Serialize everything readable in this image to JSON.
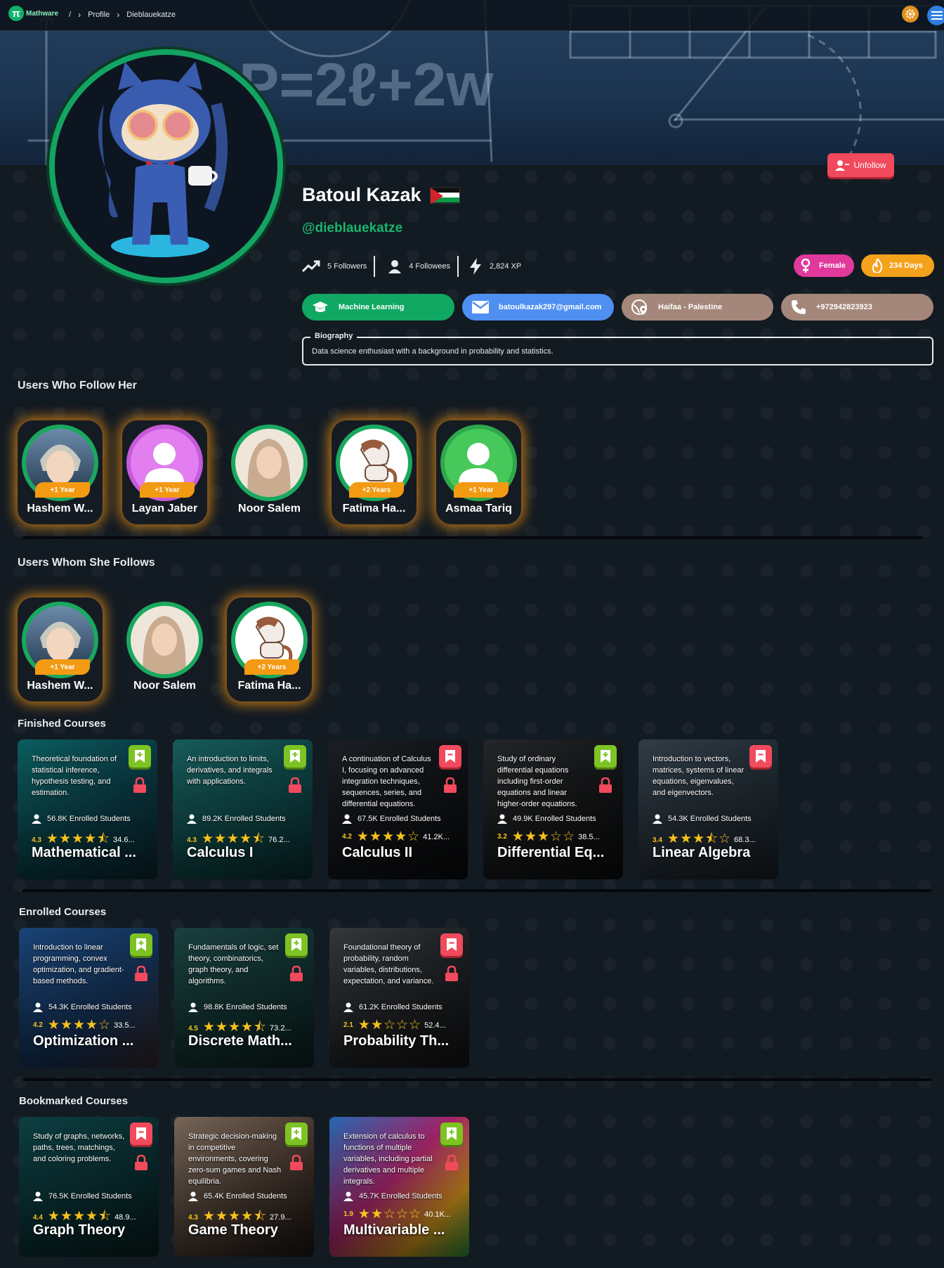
{
  "nav": {
    "logo_text": "Mathware",
    "crumbs": [
      "/",
      "Profile",
      "Dieblauekatze"
    ]
  },
  "profile": {
    "unfollow_label": "Unfollow",
    "name": "Batoul Kazak",
    "handle": "@dieblauekatze",
    "followers": "5 Followers",
    "followees": "4 Followees",
    "xp": "2,824 XP",
    "gender": "Female",
    "streak": "234 Days",
    "course_tag": "Machine Learning",
    "email": "batoulkazak297@gmail.com",
    "location": "Haifaa - Palestine",
    "phone": "+972942823923",
    "bio_label": "Biography",
    "bio": "Data science enthusiast with a background in probability and statistics."
  },
  "sections": {
    "followers_title": "Users Who Follow Her",
    "followees_title": "Users Whom She Follows",
    "finished_title": "Finished Courses",
    "enrolled_title": "Enrolled Courses",
    "bookmarked_title": "Bookmarked Courses"
  },
  "followers": [
    {
      "name": "Hashem W...",
      "badge": "+1 Year"
    },
    {
      "name": "Layan Jaber",
      "badge": "+1 Year"
    },
    {
      "name": "Noor Salem",
      "badge": ""
    },
    {
      "name": "Fatima Ha...",
      "badge": "+2 Years"
    },
    {
      "name": "Asmaa Tariq",
      "badge": "+1 Year"
    }
  ],
  "followees": [
    {
      "name": "Hashem W...",
      "badge": "+1 Year"
    },
    {
      "name": "Noor Salem",
      "badge": ""
    },
    {
      "name": "Fatima Ha...",
      "badge": "+2 Years"
    }
  ],
  "finished": [
    {
      "desc": "Theoretical foundation of statistical inference, hypothesis testing, and estimation.",
      "enrolled": "56.8K Enrolled Students",
      "rating": "4.3",
      "stars": "★★★★⯪",
      "reviews": "34.6...",
      "title": "Mathematical ..."
    },
    {
      "desc": "An introduction to limits, derivatives, and integrals with applications.",
      "enrolled": "89.2K Enrolled Students",
      "rating": "4.3",
      "stars": "★★★★⯪",
      "reviews": "76.2...",
      "title": "Calculus I"
    },
    {
      "desc": "A continuation of Calculus I, focusing on advanced integration techniques, sequences, series, and differential equations.",
      "enrolled": "67.5K Enrolled Students",
      "rating": "4.2",
      "stars": "★★★★☆",
      "reviews": "41.2K...",
      "title": "Calculus II"
    },
    {
      "desc": "Study of ordinary differential equations including first-order equations and linear higher-order equations.",
      "enrolled": "49.9K Enrolled Students",
      "rating": "3.2",
      "stars": "★★★☆☆",
      "reviews": "38.5...",
      "title": "Differential Eq..."
    },
    {
      "desc": "Introduction to vectors, matrices, systems of linear equations, eigenvalues, and eigenvectors.",
      "enrolled": "54.3K Enrolled Students",
      "rating": "3.4",
      "stars": "★★★⯪☆",
      "reviews": "68.3...",
      "title": "Linear Algebra"
    }
  ],
  "enrolled": [
    {
      "desc": "Introduction to linear programming, convex optimization, and gradient-based methods.",
      "enrolled": "54.3K Enrolled Students",
      "rating": "4.2",
      "stars": "★★★★☆",
      "reviews": "33.5...",
      "title": "Optimization ..."
    },
    {
      "desc": "Fundamentals of logic, set theory, combinatorics, graph theory, and algorithms.",
      "enrolled": "98.8K Enrolled Students",
      "rating": "4.5",
      "stars": "★★★★⯪",
      "reviews": "73.2...",
      "title": "Discrete Math..."
    },
    {
      "desc": "Foundational theory of probability, random variables, distributions, expectation, and variance.",
      "enrolled": "61.2K Enrolled Students",
      "rating": "2.1",
      "stars": "★★☆☆☆",
      "reviews": "52.4...",
      "title": "Probability Th..."
    }
  ],
  "bookmarked": [
    {
      "desc": "Study of graphs, networks, paths, trees, matchings, and coloring problems.",
      "enrolled": "76.5K Enrolled Students",
      "rating": "4.4",
      "stars": "★★★★⯪",
      "reviews": "48.9...",
      "title": "Graph Theory"
    },
    {
      "desc": "Strategic decision-making in competitive environments, covering zero-sum games and Nash equilibria.",
      "enrolled": "65.4K Enrolled Students",
      "rating": "4.3",
      "stars": "★★★★⯪",
      "reviews": "27.9...",
      "title": "Game Theory"
    },
    {
      "desc": "Extension of calculus to functions of multiple variables, including partial derivatives and multiple integrals.",
      "enrolled": "45.7K Enrolled Students",
      "rating": "1.9",
      "stars": "★★☆☆☆",
      "reviews": "40.1K...",
      "title": "Multivariable ..."
    }
  ],
  "banner": {
    "formula": "P=2ℓ+2w"
  },
  "colors": {
    "accent": "#13a463",
    "danger": "#f04a5c",
    "warning": "#f39a13"
  }
}
